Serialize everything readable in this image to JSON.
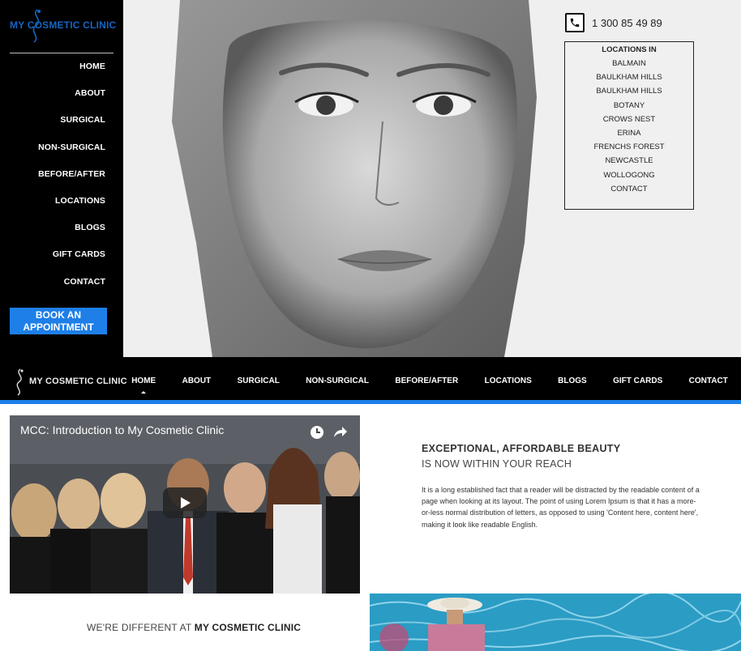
{
  "brand": {
    "name": "MY COSMETIC CLINIC",
    "name_prefix": "MY",
    "name_rest": "COSMETIC CLINIC",
    "accent_color": "#1e7fe8"
  },
  "sidebar": {
    "items": [
      "HOME",
      "ABOUT",
      "SURGICAL",
      "NON-SURGICAL",
      "BEFORE/AFTER",
      "LOCATIONS",
      "BLOGS",
      "GIFT CARDS",
      "CONTACT"
    ],
    "book_button": "BOOK AN APPOINTMENT"
  },
  "header": {
    "phone_icon": "phone-icon",
    "phone": "1 300 85 49 89"
  },
  "locations": {
    "title": "LOCATIONS IN",
    "items": [
      "BALMAIN",
      "BAULKHAM HILLS",
      "BAULKHAM HILLS",
      "BOTANY",
      "CROWS NEST",
      "ERINA",
      "FRENCHS FOREST",
      "NEWCASTLE",
      "WOLLOGONG",
      "CONTACT"
    ]
  },
  "navbar": {
    "items": [
      "HOME",
      "ABOUT",
      "SURGICAL",
      "NON-SURGICAL",
      "BEFORE/AFTER",
      "LOCATIONS",
      "BLOGS",
      "GIFT CARDS",
      "CONTACT"
    ],
    "active": "HOME"
  },
  "video": {
    "title": "MCC: Introduction to My Cosmetic Clinic",
    "icons": [
      "clock-icon",
      "share-icon",
      "play-icon"
    ]
  },
  "intro": {
    "heading": "EXCEPTIONAL, AFFORDABLE BEAUTY",
    "subheading": "IS NOW WITHIN YOUR REACH",
    "body": "It is a long established fact that a reader will be distracted by the readable content of a page when looking at its layout. The point of using Lorem Ipsum is that it has a more-or-less normal distribution of letters, as opposed to using 'Content here, content here', making it look like readable English."
  },
  "different": {
    "lead": "WE'RE DIFFERENT AT ",
    "strong": "MY COSMETIC CLINIC"
  }
}
